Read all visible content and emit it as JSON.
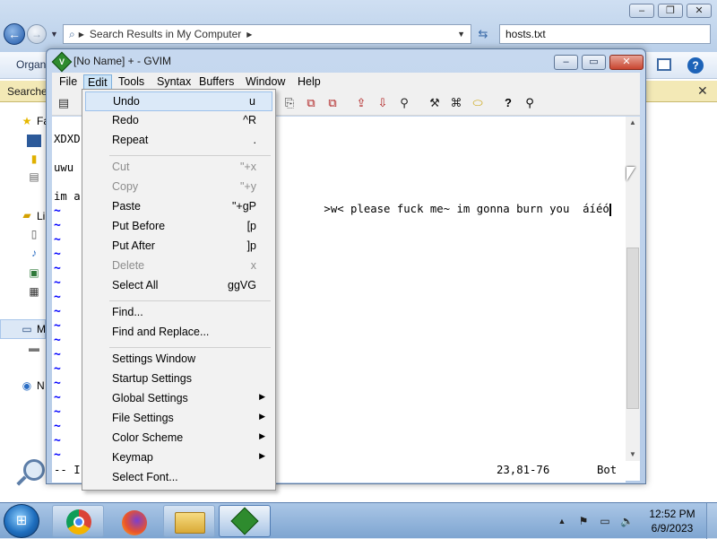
{
  "explorer": {
    "address_path": "Search Results in My Computer",
    "search_value": "hosts.txt",
    "toolbar_organize": "Organ",
    "infobar_text": "Searche",
    "sidebar_labels": [
      "Fa",
      "Li",
      "M",
      "N"
    ]
  },
  "gvim": {
    "title": "[No Name] + - GVIM",
    "menubar": [
      "File",
      "Edit",
      "Tools",
      "Syntax",
      "Buffers",
      "Window",
      "Help"
    ],
    "lines": [
      "XDXD",
      "",
      "uwu",
      "",
      "im a",
      ">w< please fuck me~ im gonna burn you  áíéó"
    ],
    "tilde_char": "~",
    "status": {
      "mode_fragment": "-- I",
      "position": "23,81-76",
      "scroll": "Bot"
    }
  },
  "edit_menu": {
    "items": [
      {
        "label": "Undo",
        "key": "u"
      },
      {
        "label": "Redo",
        "key": "^R"
      },
      {
        "label": "Repeat",
        "key": "."
      },
      {
        "label": "Cut",
        "key": "\"+x"
      },
      {
        "label": "Copy",
        "key": "\"+y"
      },
      {
        "label": "Paste",
        "key": "\"+gP"
      },
      {
        "label": "Put Before",
        "key": "[p"
      },
      {
        "label": "Put After",
        "key": "]p"
      },
      {
        "label": "Delete",
        "key": "x"
      },
      {
        "label": "Select All",
        "key": "ggVG"
      },
      {
        "label": "Find...",
        "key": ""
      },
      {
        "label": "Find and Replace...",
        "key": ""
      },
      {
        "label": "Settings Window",
        "key": ""
      },
      {
        "label": "Startup Settings",
        "key": ""
      },
      {
        "label": "Global Settings",
        "key": ""
      },
      {
        "label": "File Settings",
        "key": ""
      },
      {
        "label": "Color Scheme",
        "key": ""
      },
      {
        "label": "Keymap",
        "key": ""
      },
      {
        "label": "Select Font...",
        "key": ""
      }
    ]
  },
  "taskbar": {
    "time": "12:52 PM",
    "date": "6/9/2023"
  }
}
